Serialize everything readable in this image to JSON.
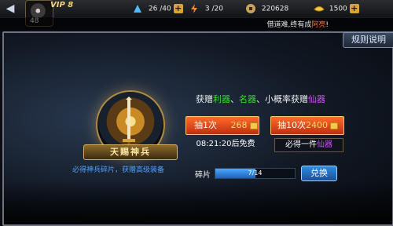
{
  "topbar": {
    "back_icon": "back-arrow-icon",
    "vip_label": "VIP 8",
    "level": "48",
    "stamina": "26 /40",
    "energy": "3 /20",
    "gold": "220628",
    "ingots": "1500"
  },
  "ticker": {
    "text_prefix": "借道难,终有成",
    "highlight": "阿亮",
    "text_suffix": "!"
  },
  "panel": {
    "rules_button": "规则说明",
    "emblem_label": "天赐神兵",
    "emblem_desc": "必得神兵碎片，获赠高级装备"
  },
  "rewards": {
    "p1": "获赠",
    "h1": "利器",
    "sep": "、",
    "h2": "名器",
    "p2": "、小概率获赠",
    "h3": "仙器"
  },
  "draw1": {
    "label": "抽1次",
    "price": "268",
    "free_timer": "08:21:20后免费"
  },
  "draw10": {
    "label": "抽10次",
    "price": "2400",
    "guarantee_prefix": "必得一件",
    "guarantee_item": "仙器"
  },
  "fragments": {
    "label": "碎片",
    "progress_text": "7/14",
    "progress_fraction": 0.5,
    "exchange_button": "兑换"
  },
  "colors": {
    "accent_orange": "#ff6b2c",
    "green": "#34e02d",
    "purple": "#d54cff",
    "blue": "#2e8ce0"
  }
}
